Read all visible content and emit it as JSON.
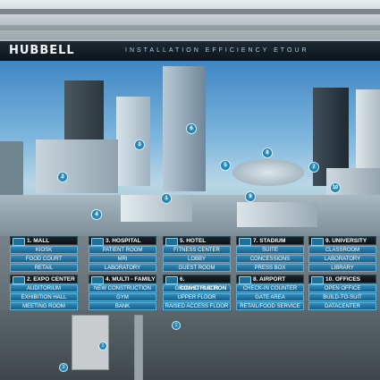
{
  "header": {
    "logo": "HUBBELL",
    "title": "INSTALLATION EFFICIENCY ETOUR"
  },
  "hotspots": [
    "1",
    "2",
    "3",
    "4",
    "5",
    "6",
    "7",
    "8",
    "9",
    "10"
  ],
  "bottom_hotspots": [
    "1",
    "2",
    "3"
  ],
  "categories": [
    {
      "label": "1. MALL",
      "items": [
        "KIOSK",
        "FOOD COURT",
        "RETAIL"
      ]
    },
    {
      "label": "3. HOSPITAL",
      "items": [
        "PATIENT ROOM",
        "MRI",
        "LABORATORY"
      ]
    },
    {
      "label": "5. HOTEL",
      "items": [
        "FITNESS CENTER",
        "LOBBY",
        "GUEST ROOM"
      ]
    },
    {
      "label": "7. STADIUM",
      "items": [
        "SUITE",
        "CONCESSIONS",
        "PRESS BOX"
      ]
    },
    {
      "label": "9. UNIVERSITY",
      "items": [
        "CLASSROOM",
        "LABORATORY",
        "LIBRARY"
      ]
    },
    {
      "label": "2. EXPO CENTER",
      "items": [
        "AUDITORIUM",
        "EXHIBITION HALL",
        "MEETING ROOM"
      ]
    },
    {
      "label": "4. MULTI - FAMILY",
      "items": [
        "NEW CONSTRUCTION",
        "GYM",
        "BANK"
      ]
    },
    {
      "label": "6. CONSTRUCTION",
      "items": [
        "GROUND FLOOR",
        "UPPER FLOOR",
        "RAISED ACCESS FLOOR"
      ]
    },
    {
      "label": "8. AIRPORT",
      "items": [
        "CHECK-IN COUNTER",
        "GATE AREA",
        "RETAIL/FOOD SERVICE"
      ]
    },
    {
      "label": "10. OFFICES",
      "items": [
        "OPEN OFFICE",
        "BUILD-TO-SUIT",
        "DATACENTER"
      ]
    }
  ]
}
